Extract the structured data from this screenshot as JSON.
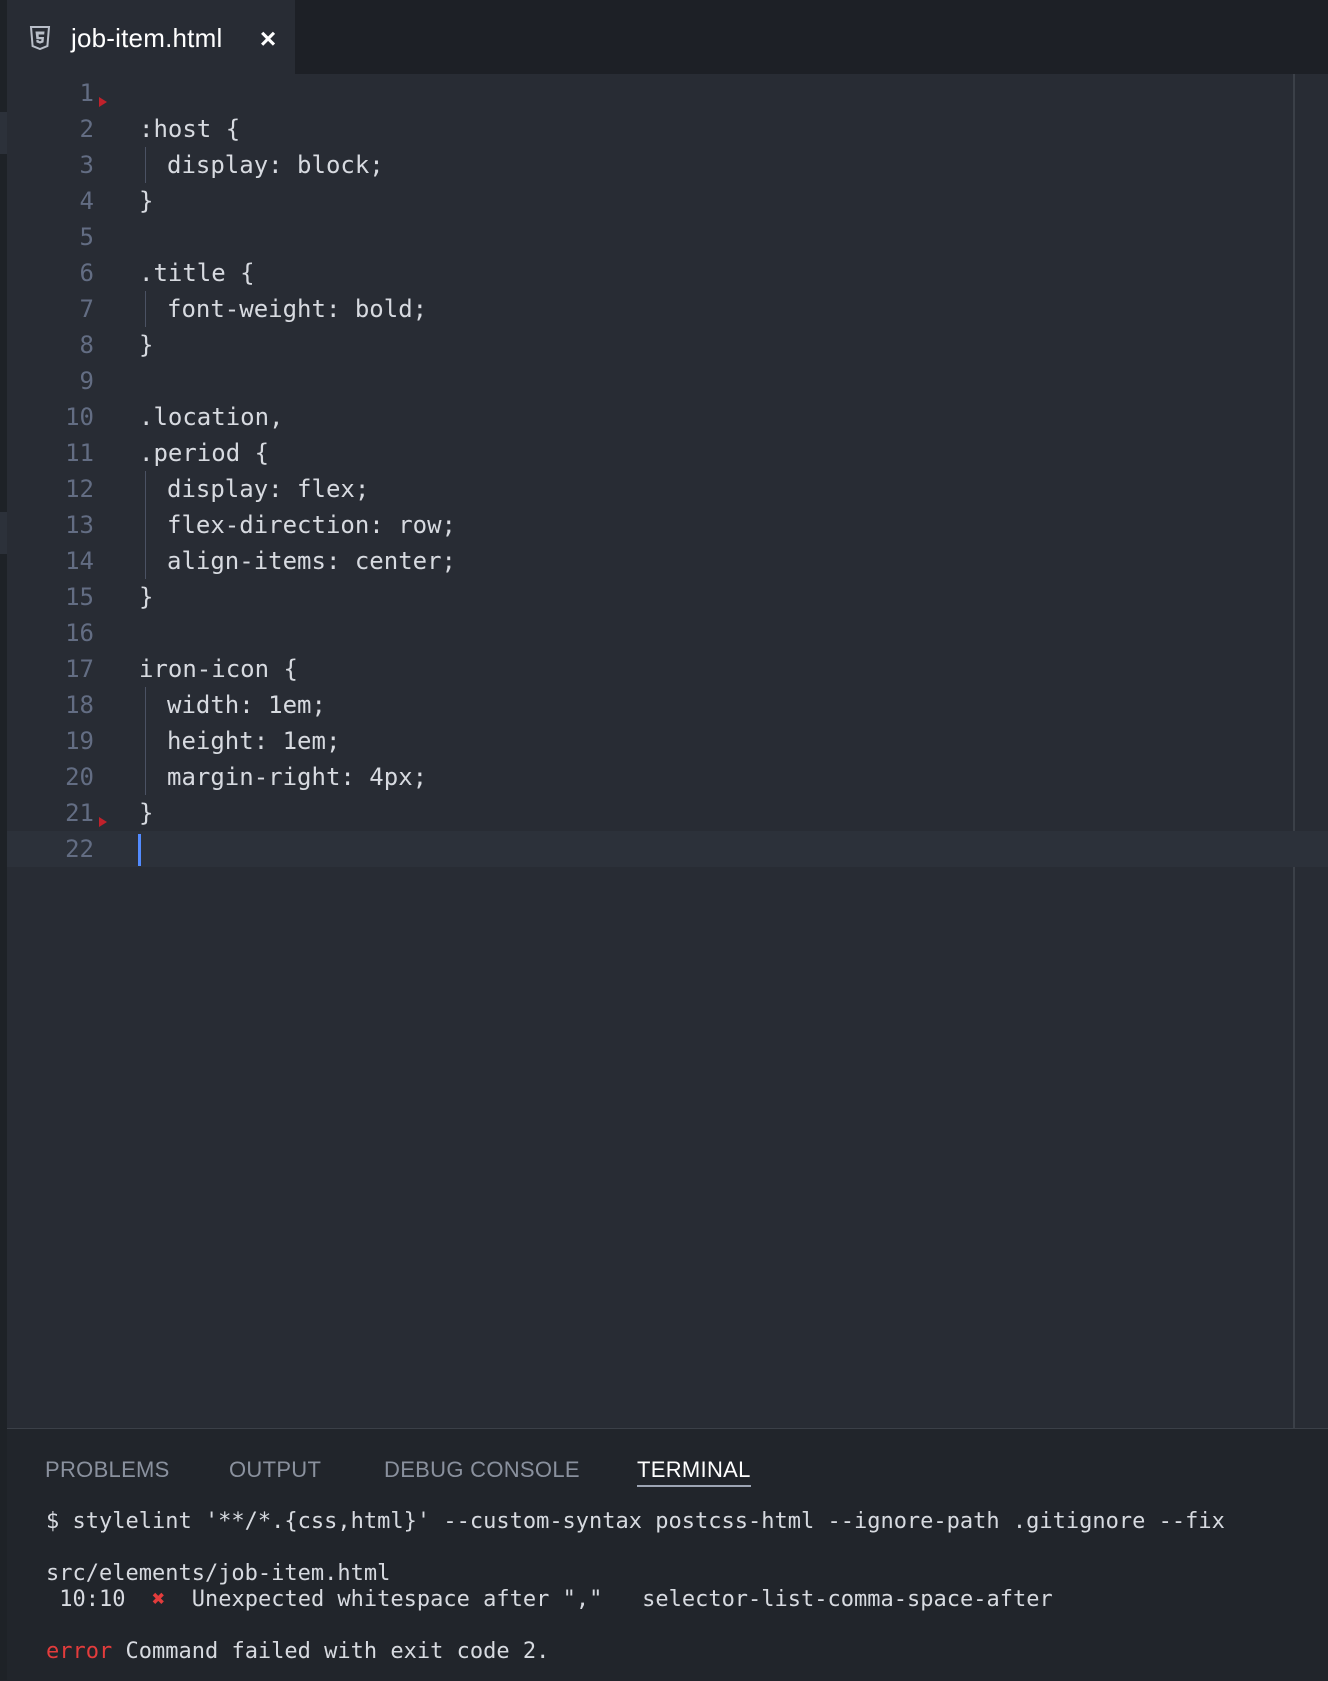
{
  "tab": {
    "title": "job-item.html",
    "file_icon": "html5-icon",
    "close_icon": "close-icon"
  },
  "editor": {
    "lines": [
      {
        "num": "1",
        "text": "",
        "indent": false
      },
      {
        "num": "2",
        "text": ":host {",
        "indent": false
      },
      {
        "num": "3",
        "text": "display: block;",
        "indent": true
      },
      {
        "num": "4",
        "text": "}",
        "indent": false
      },
      {
        "num": "5",
        "text": "",
        "indent": false
      },
      {
        "num": "6",
        "text": ".title {",
        "indent": false
      },
      {
        "num": "7",
        "text": "font-weight: bold;",
        "indent": true
      },
      {
        "num": "8",
        "text": "}",
        "indent": false
      },
      {
        "num": "9",
        "text": "",
        "indent": false
      },
      {
        "num": "10",
        "text": ".location,",
        "indent": false
      },
      {
        "num": "11",
        "text": ".period {",
        "indent": false
      },
      {
        "num": "12",
        "text": "display: flex;",
        "indent": true
      },
      {
        "num": "13",
        "text": "flex-direction: row;",
        "indent": true
      },
      {
        "num": "14",
        "text": "align-items: center;",
        "indent": true
      },
      {
        "num": "15",
        "text": "}",
        "indent": false
      },
      {
        "num": "16",
        "text": "",
        "indent": false
      },
      {
        "num": "17",
        "text": "iron-icon {",
        "indent": false
      },
      {
        "num": "18",
        "text": "width: 1em;",
        "indent": true
      },
      {
        "num": "19",
        "text": "height: 1em;",
        "indent": true
      },
      {
        "num": "20",
        "text": "margin-right: 4px;",
        "indent": true
      },
      {
        "num": "21",
        "text": "}",
        "indent": false
      },
      {
        "num": "22",
        "text": "",
        "indent": false
      }
    ],
    "current_line": "22"
  },
  "panel": {
    "tabs": [
      {
        "label": "PROBLEMS",
        "active": false
      },
      {
        "label": "OUTPUT",
        "active": false
      },
      {
        "label": "DEBUG CONSOLE",
        "active": false
      },
      {
        "label": "TERMINAL",
        "active": true
      }
    ],
    "terminal": {
      "command": "$ stylelint '**/*.{css,html}' --custom-syntax postcss-html --ignore-path .gitignore --fix",
      "file": "src/elements/job-item.html",
      "warning_position": " 10:10",
      "warning_symbol": "✖",
      "warning_message": "Unexpected whitespace after \",\"",
      "warning_rule": "selector-list-comma-space-after",
      "error_label": "error",
      "error_message": "Command failed with exit code 2."
    }
  },
  "colors": {
    "editor_bg": "#282c34",
    "panel_bg": "#21252b",
    "error_red": "#e33c3c",
    "cursor_blue": "#528bff",
    "line_number": "#636d83"
  }
}
